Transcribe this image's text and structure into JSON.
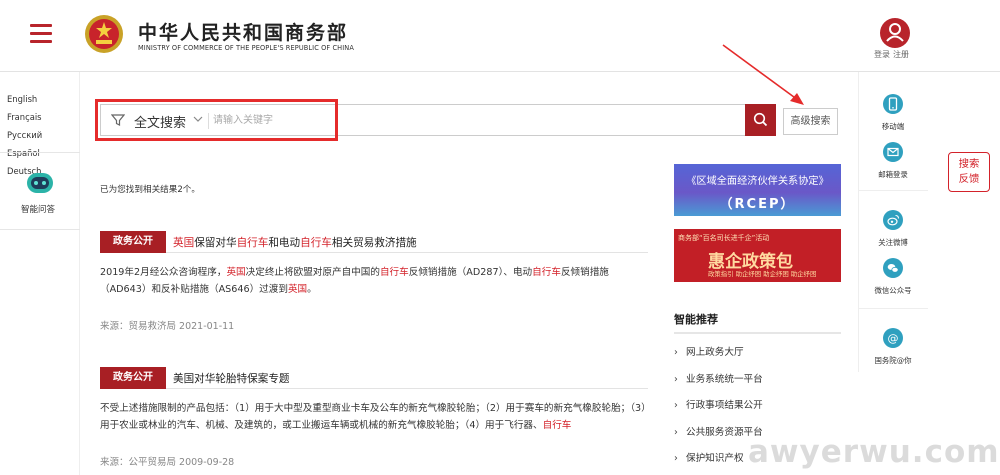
{
  "header": {
    "site_title": "中华人民共和国商务部",
    "site_subtitle": "MINISTRY OF COMMERCE OF THE PEOPLE'S REPUBLIC OF CHINA",
    "login": "登录",
    "register": "注册"
  },
  "left_sidebar": {
    "languages": [
      "English",
      "Français",
      "Русский",
      "Español",
      "Deutsch"
    ],
    "qa_label": "智能问答"
  },
  "search": {
    "type": "全文搜索",
    "placeholder": "请输入关键字",
    "advanced": "高级搜索"
  },
  "results": {
    "count_text": "已为您找到相关结果2个。",
    "items": [
      {
        "tag": "政务公开",
        "title_parts": [
          {
            "text": "英国",
            "hl": true
          },
          {
            "text": "保留对华",
            "hl": false
          },
          {
            "text": "自行车",
            "hl": true
          },
          {
            "text": "和电动",
            "hl": false
          },
          {
            "text": "自行车",
            "hl": true
          },
          {
            "text": "相关贸易救济措施",
            "hl": false
          }
        ],
        "snippet_parts": [
          {
            "text": "2019年2月经公众咨询程序，",
            "hl": false
          },
          {
            "text": "英国",
            "hl": true
          },
          {
            "text": "决定终止将欧盟对原产自中国的",
            "hl": false
          },
          {
            "text": "自行车",
            "hl": true
          },
          {
            "text": "反倾销措施（AD287）、电动",
            "hl": false
          },
          {
            "text": "自行车",
            "hl": true
          },
          {
            "text": "反倾销措施（AD643）和反补贴措施（AS646）过渡到",
            "hl": false
          },
          {
            "text": "英国",
            "hl": true
          },
          {
            "text": "。",
            "hl": false
          }
        ],
        "source": "来源：贸易救济局 2021-01-11"
      },
      {
        "tag": "政务公开",
        "title_parts": [
          {
            "text": "美国对华轮胎特保案专题",
            "hl": false
          }
        ],
        "snippet_parts": [
          {
            "text": "不受上述措施限制的产品包括：（1）用于大中型及重型商业卡车及公车的新充气橡胶轮胎；（2）用于赛车的新充气橡胶轮胎；（3）用于农业或林业的汽车、机械、及建筑的，或工业搬运车辆或机械的新充气橡胶轮胎；（4）用于飞行器、",
            "hl": false
          },
          {
            "text": "自行车",
            "hl": true
          }
        ],
        "source": "来源：公平贸易局 2009-09-28"
      }
    ]
  },
  "banners": {
    "rcep_line1": "《区域全面经济伙伴关系协定》",
    "rcep_line2": "（RCEP）",
    "policy_line1": "商务部“百名司长进千企”活动",
    "policy_main": "惠企政策包",
    "policy_tags": "政策指引  助企纾困  助企纾困  助企纾困"
  },
  "recommend": {
    "title": "智能推荐",
    "items": [
      "网上政务大厅",
      "业务系统统一平台",
      "行政事项结果公开",
      "公共服务资源平台",
      "保护知识产权"
    ]
  },
  "right_sidebar": {
    "items": [
      "移动端",
      "邮箱登录",
      "关注微博",
      "微信公众号",
      "国务院@你"
    ]
  },
  "feedback": {
    "line1": "搜索",
    "line2": "反馈"
  },
  "watermark": "awyerwu.com",
  "colors": {
    "brand_red": "#a81f24",
    "highlight_red": "#d3222a",
    "teal_icon": "#2fa0bf",
    "annotation_red": "#e52b2b"
  }
}
